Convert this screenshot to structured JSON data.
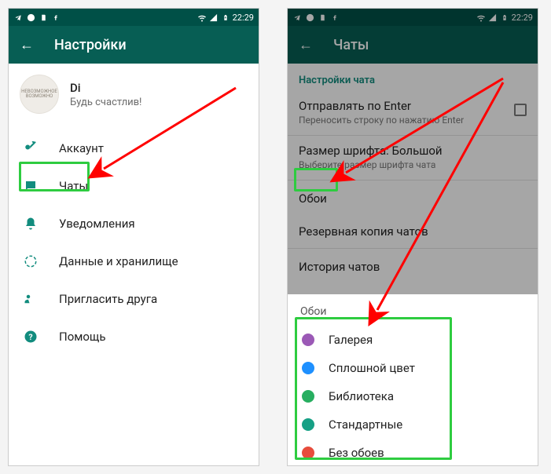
{
  "statusbar": {
    "time": "22:29"
  },
  "left": {
    "appbar": {
      "title": "Настройки"
    },
    "profile": {
      "name": "Di",
      "status": "Будь счастлив!",
      "avatar_text": "НЕВОЗМОЖНОЕ\nВОЗМОЖНО"
    },
    "menu": [
      {
        "icon": "key-icon",
        "label": "Аккаунт"
      },
      {
        "icon": "chat-icon",
        "label": "Чаты"
      },
      {
        "icon": "bell-icon",
        "label": "Уведомления"
      },
      {
        "icon": "data-icon",
        "label": "Данные и хранилище"
      },
      {
        "icon": "invite-icon",
        "label": "Пригласить друга"
      },
      {
        "icon": "help-icon",
        "label": "Помощь"
      }
    ]
  },
  "right": {
    "appbar": {
      "title": "Чаты"
    },
    "section_label": "Настройки чата",
    "settings": [
      {
        "title": "Отправлять по Enter",
        "sub": "Переносить строку по нажатию Enter",
        "checkbox": true
      },
      {
        "title": "Размер шрифта: Большой",
        "sub": "Выберите размер шрифта чата"
      },
      {
        "title": "Обои"
      },
      {
        "title": "Резервная копия чатов",
        "sub": ""
      },
      {
        "title": "История чатов"
      }
    ],
    "sheet": {
      "title": "Обои",
      "items": [
        {
          "color": "#9b59b6",
          "label": "Галерея"
        },
        {
          "color": "#1e90ff",
          "label": "Сплошной цвет"
        },
        {
          "color": "#27ae60",
          "label": "Библиотека"
        },
        {
          "color": "#16a085",
          "label": "Стандартные"
        },
        {
          "color": "#e74c3c",
          "label": "Без обоев"
        }
      ]
    }
  }
}
